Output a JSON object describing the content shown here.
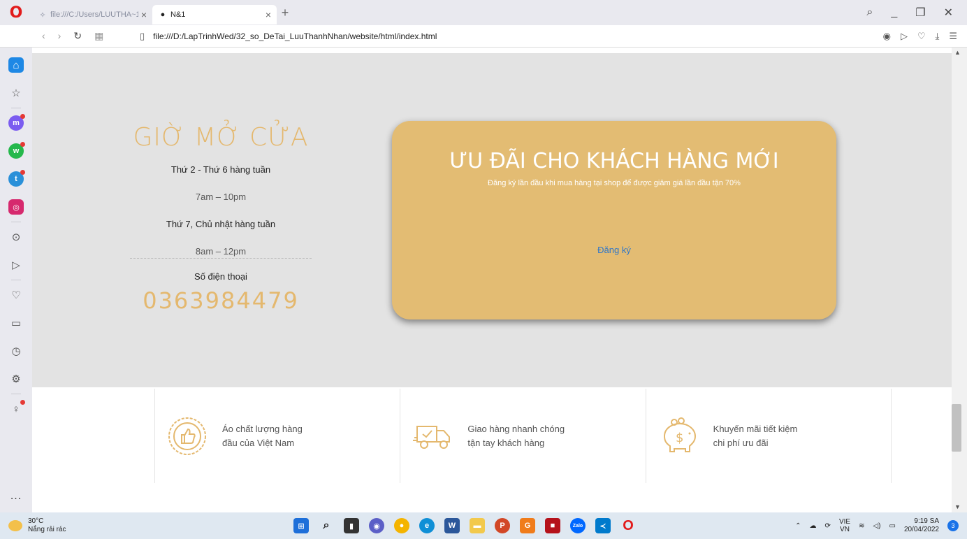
{
  "browser": {
    "tabs": [
      {
        "title": "file:///C:/Users/LUUTHA~1/",
        "active": false
      },
      {
        "title": "N&1",
        "active": true
      }
    ],
    "url": "file:///D:/LapTrinhWed/32_so_DeTai_LuuThanhNhan/website/html/index.html"
  },
  "sidebar": {
    "items": [
      "home-icon",
      "star-icon",
      "messenger-icon",
      "whatsapp-icon",
      "telegram-icon",
      "instagram-icon",
      "player-icon",
      "send-icon",
      "heart-icon",
      "wallet-icon",
      "history-icon",
      "settings-icon",
      "lightbulb-icon"
    ],
    "more": "..."
  },
  "hours": {
    "title": "GIỜ MỞ CỬA",
    "weekday_label": "Thứ 2 - Thứ 6 hàng tuần",
    "weekday_time": "7am – 10pm",
    "weekend_label": "Thứ 7, Chủ nhật hàng tuần",
    "weekend_time": "8am – 12pm",
    "phone_label": "Số điện thoại",
    "phone": "0363984479"
  },
  "promo": {
    "title": "ƯU ĐÃI CHO KHÁCH HÀNG MỚI",
    "subtitle": "Đăng ký lần đầu khi mua hàng tại shop để được giảm giá lần đầu tận 70%",
    "link": "Đăng ký"
  },
  "features": [
    {
      "icon": "thumbs-up-badge-icon",
      "line1": "Áo chất lượng hàng",
      "line2": "đầu của Việt Nam"
    },
    {
      "icon": "delivery-truck-icon",
      "line1": "Giao hàng nhanh chóng",
      "line2": "tận tay khách hàng"
    },
    {
      "icon": "piggy-bank-icon",
      "line1": "Khuyến mãi tiết kiệm",
      "line2": "chi phí ưu đãi"
    }
  ],
  "taskbar": {
    "temp": "30°C",
    "weather": "Nắng rải rác",
    "lang1": "VIE",
    "lang2": "VN",
    "time": "9:19 SA",
    "date": "20/04/2022",
    "notifications": "3"
  },
  "colors": {
    "accent_gold": "#e4b86e",
    "promo_bg": "#e3bc73",
    "hero_bg": "#e3e3e3",
    "link_blue": "#2e76c8"
  }
}
